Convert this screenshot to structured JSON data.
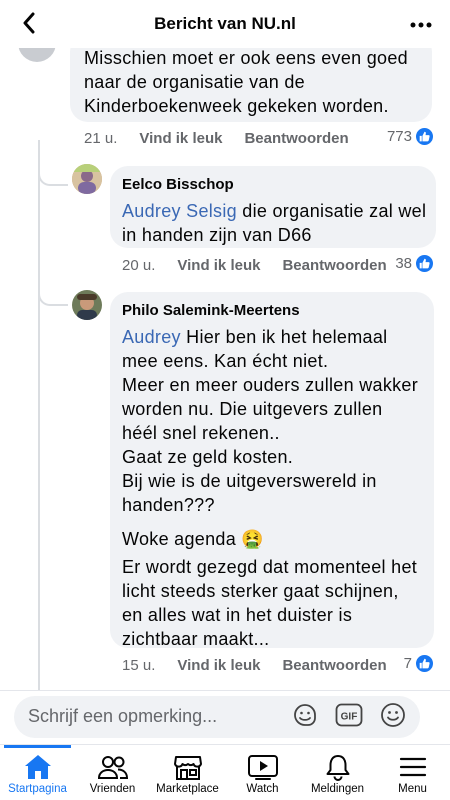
{
  "header": {
    "title": "Bericht van NU.nl"
  },
  "comments": [
    {
      "lines": [
        "Misschien moet er ook eens even goed",
        "naar de organisatie van de",
        "Kinderboekenweek gekeken worden."
      ],
      "time": "21 u.",
      "like_label": "Vind ik leuk",
      "reply_label": "Beantwoorden",
      "reactions": "773"
    },
    {
      "author": "Eelco Bisschop",
      "mention": "Audrey Selsig",
      "line1_rest": " die organisatie zal wel",
      "line2": "in handen zijn van D66",
      "time": "20 u.",
      "like_label": "Vind ik leuk",
      "reply_label": "Beantwoorden",
      "reactions": "38"
    },
    {
      "author": "Philo Salemink-Meertens",
      "mention": "Audrey",
      "line1_rest": "  Hier ben ik het helemaal",
      "para1": [
        "mee eens.  Kan écht niet.",
        "Meer en meer ouders zullen wakker",
        "worden nu.  Die uitgevers zullen",
        "héél snel rekenen..",
        "Gaat ze geld kosten.",
        "Bij wie is de uitgeverswereld in",
        "handen???"
      ],
      "para2": "Woke agenda 🤮",
      "para3": [
        "Er wordt gezegd dat momenteel het",
        "licht steeds sterker gaat schijnen,",
        "en alles wat in het duister is",
        "zichtbaar maakt..."
      ],
      "time": "15 u.",
      "like_label": "Vind ik leuk",
      "reply_label": "Beantwoorden",
      "reactions": "7"
    }
  ],
  "composer": {
    "placeholder": "Schrijf een opmerking..."
  },
  "tabs": [
    {
      "label": "Startpagina",
      "icon": "home-icon",
      "active": true
    },
    {
      "label": "Vrienden",
      "icon": "friends-icon"
    },
    {
      "label": "Marketplace",
      "icon": "marketplace-icon"
    },
    {
      "label": "Watch",
      "icon": "watch-icon"
    },
    {
      "label": "Meldingen",
      "icon": "bell-icon"
    },
    {
      "label": "Menu",
      "icon": "menu-icon"
    }
  ],
  "colors": {
    "accent": "#1877f2",
    "bubble": "#f0f2f5",
    "mention": "#3a68b4",
    "meta": "#65676b"
  }
}
